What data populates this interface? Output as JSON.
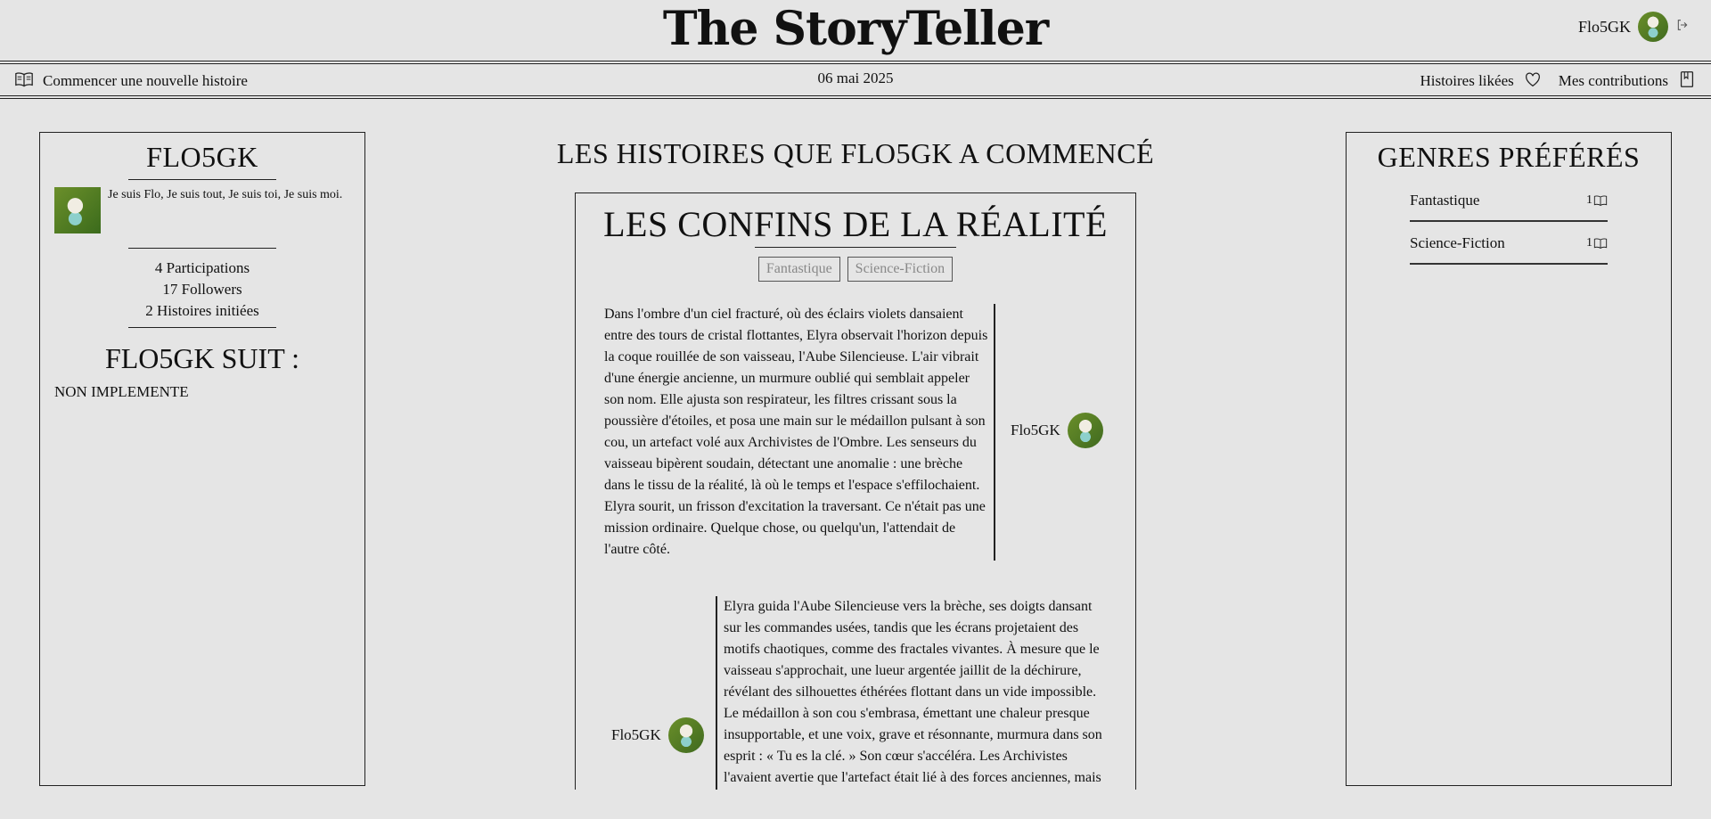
{
  "header": {
    "brand": "The StoryTeller",
    "username": "Flo5GK"
  },
  "nav": {
    "new_story": "Commencer une nouvelle histoire",
    "date": "06 mai 2025",
    "liked": "Histoires likées",
    "contributions": "Mes contributions"
  },
  "profile": {
    "name": "FLO5GK",
    "bio": "Je suis Flo, Je suis tout, Je suis toi, Je suis moi.",
    "participations": "4 Participations",
    "followers": "17 Followers",
    "stories_started": "2 Histoires initiées",
    "follows_title": "FLO5GK SUIT :",
    "follows_text": "NON IMPLEMENTE"
  },
  "main": {
    "title": "LES HISTOIRES QUE FLO5GK A COMMENCÉ",
    "story": {
      "title": "LES CONFINS DE LA RÉALITÉ",
      "tags": [
        "Fantastique",
        "Science-Fiction"
      ],
      "segments": [
        {
          "author": "Flo5GK",
          "text": "Dans l'ombre d'un ciel fracturé, où des éclairs violets dansaient entre des tours de cristal flottantes, Elyra observait l'horizon depuis la coque rouillée de son vaisseau, l'Aube Silencieuse. L'air vibrait d'une énergie ancienne, un murmure oublié qui semblait appeler son nom. Elle ajusta son respirateur, les filtres crissant sous la poussière d'étoiles, et posa une main sur le médaillon pulsant à son cou, un artefact volé aux Archivistes de l'Ombre. Les senseurs du vaisseau bipèrent soudain, détectant une anomalie : une brèche dans le tissu de la réalité, là où le temps et l'espace s'effilochaient. Elyra sourit, un frisson d'excitation la traversant. Ce n'était pas une mission ordinaire. Quelque chose, ou quelqu'un, l'attendait de l'autre côté."
        },
        {
          "author": "Flo5GK",
          "text": "Elyra guida l'Aube Silencieuse vers la brèche, ses doigts dansant sur les commandes usées, tandis que les écrans projetaient des motifs chaotiques, comme des fractales vivantes. À mesure que le vaisseau s'approchait, une lueur argentée jaillit de la déchirure, révélant des silhouettes éthérées flottant dans un vide impossible. Le médaillon à son cou s'embrasa, émettant une chaleur presque insupportable, et une voix, grave et résonnante, murmura dans son esprit : « Tu es la clé. » Son cœur s'accéléra. Les Archivistes l'avaient avertie que l'artefact était lié à des forces anciennes, mais"
        }
      ]
    }
  },
  "genres": {
    "title": "GENRES PRÉFÉRÉS",
    "items": [
      {
        "name": "Fantastique",
        "count": "1"
      },
      {
        "name": "Science-Fiction",
        "count": "1"
      }
    ]
  }
}
